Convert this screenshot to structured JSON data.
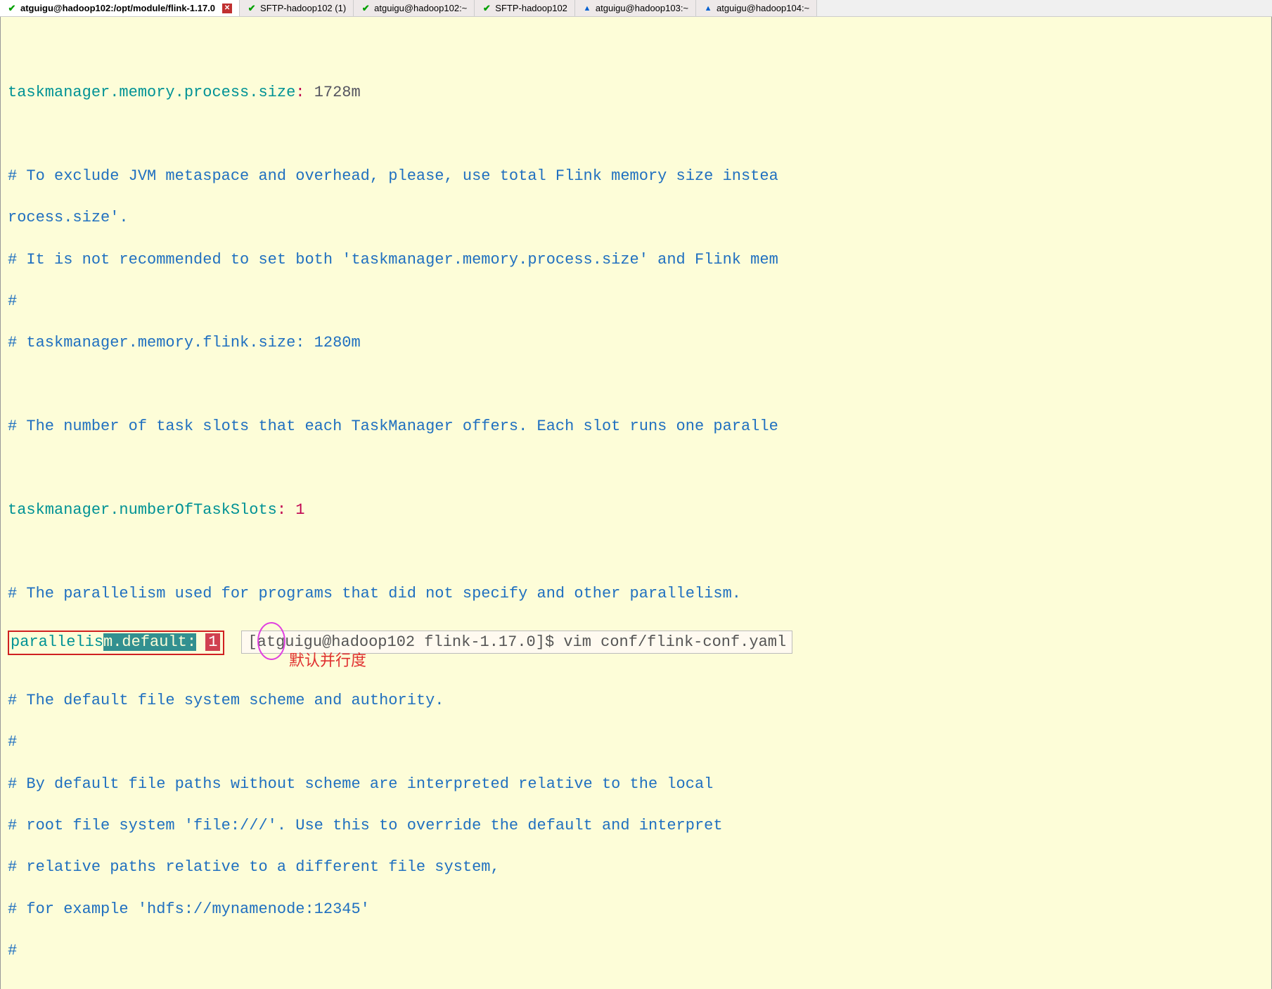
{
  "tabs": [
    {
      "label": "atguigu@hadoop102:/opt/module/flink-1.17.0",
      "icon": "check-green",
      "active": true,
      "closeable": true
    },
    {
      "label": "SFTP-hadoop102 (1)",
      "icon": "check-green",
      "active": false,
      "closeable": false
    },
    {
      "label": "atguigu@hadoop102:~",
      "icon": "check-green",
      "active": false,
      "closeable": false
    },
    {
      "label": "SFTP-hadoop102",
      "icon": "check-green",
      "active": false,
      "closeable": false
    },
    {
      "label": "atguigu@hadoop103:~",
      "icon": "warn-blue",
      "active": false,
      "closeable": false
    },
    {
      "label": "atguigu@hadoop104:~",
      "icon": "warn-blue",
      "active": false,
      "closeable": false
    }
  ],
  "config": {
    "process_size_key": "taskmanager.memory.process.size",
    "process_size_value": "1728m",
    "comment_exclude": "# To exclude JVM metaspace and overhead, please, use total Flink memory size instea",
    "comment_rocess": "rocess.size'.",
    "comment_not_recommended": "# It is not recommended to set both 'taskmanager.memory.process.size' and Flink mem",
    "comment_hash": "#",
    "comment_flink_size": "# taskmanager.memory.flink.size: 1280m",
    "comment_task_slots": "# The number of task slots that each TaskManager offers. Each slot runs one paralle",
    "slots_key": "taskmanager.numberOfTaskSlots",
    "slots_value": "1",
    "comment_parallelism": "# The parallelism used for programs that did not specify and other parallelism.",
    "parallelism_prefix": "parallelis",
    "parallelism_selected": "m.default:",
    "parallelism_value": "1",
    "tooltip_text": "[atguigu@hadoop102 flink-1.17.0]$ vim conf/flink-conf.yaml",
    "annotation": "默认并行度",
    "comment_fs_scheme": "# The default file system scheme and authority.",
    "comment_fs_1": "# By default file paths without scheme are interpreted relative to the local",
    "comment_fs_2": "# root file system 'file:///'. Use this to override the default and interpret",
    "comment_fs_3": "# relative paths relative to a different file system,",
    "comment_fs_4": "# for example 'hdfs://mynamenode:12345'"
  }
}
